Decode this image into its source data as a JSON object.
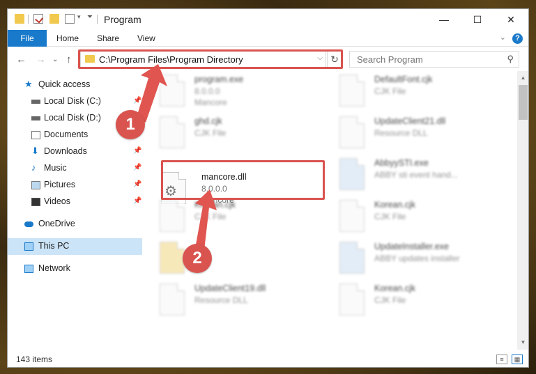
{
  "window": {
    "title": "Program",
    "controls": {
      "minimize": "—",
      "maximize": "☐",
      "close": "✕"
    }
  },
  "ribbon": {
    "tabs": [
      {
        "label": "File"
      },
      {
        "label": "Home"
      },
      {
        "label": "Share"
      },
      {
        "label": "View"
      }
    ],
    "expand_glyph": "⌄",
    "help_glyph": "?"
  },
  "nav": {
    "back": "←",
    "forward": "→",
    "recent": "⌄",
    "up": "↑",
    "address": "C:\\Program Files\\Program Directory",
    "refresh": "↻",
    "search_placeholder": "Search Program"
  },
  "sidebar": {
    "items": [
      {
        "label": "Quick access",
        "icon": "star-icon"
      },
      {
        "label": "Local Disk (C:)",
        "icon": "drive-icon"
      },
      {
        "label": "Local Disk (D:)",
        "icon": "drive-icon"
      },
      {
        "label": "Documents",
        "icon": "documents-icon"
      },
      {
        "label": "Downloads",
        "icon": "download-icon"
      },
      {
        "label": "Music",
        "icon": "music-icon"
      },
      {
        "label": "Pictures",
        "icon": "pictures-icon"
      },
      {
        "label": "Videos",
        "icon": "videos-icon"
      },
      {
        "label": "OneDrive",
        "icon": "cloud-icon"
      },
      {
        "label": "This PC",
        "icon": "computer-icon"
      },
      {
        "label": "Network",
        "icon": "network-icon"
      }
    ]
  },
  "files": [
    {
      "name": "program.exe",
      "line2": "8.0.0.0",
      "line3": "Mancore"
    },
    {
      "name": "DefaultFont.cjk",
      "line2": "CJK File",
      "line3": ""
    },
    {
      "name": "ghd.cjk",
      "line2": "CJK File",
      "line3": ""
    },
    {
      "name": "UpdateClient21.dll",
      "line2": "Resource DLL",
      "line3": ""
    },
    {
      "name": "mancore.dll",
      "line2": "8.0.0.0",
      "line3": "Mancore"
    },
    {
      "name": "AbbyySTI.exe",
      "line2": "ABBY sti event hand...",
      "line3": ""
    },
    {
      "name": "Korean.cjk",
      "line2": "CJK File",
      "line3": ""
    },
    {
      "name": "Korean.cjk",
      "line2": "CJK File",
      "line3": ""
    },
    {
      "name": "",
      "line2": "",
      "line3": ""
    },
    {
      "name": "UpdateInstaller.exe",
      "line2": "ABBY updates installer",
      "line3": ""
    },
    {
      "name": "UpdateClient19.dll",
      "line2": "Resource DLL",
      "line3": ""
    },
    {
      "name": "Korean.cjk",
      "line2": "CJK File",
      "line3": ""
    }
  ],
  "status": {
    "count": "143 items"
  },
  "callouts": [
    "1",
    "2"
  ],
  "colors": {
    "accent": "#1979ca",
    "highlight": "#d9534f",
    "folder": "#f1c94e",
    "selected": "#cce4f7"
  }
}
